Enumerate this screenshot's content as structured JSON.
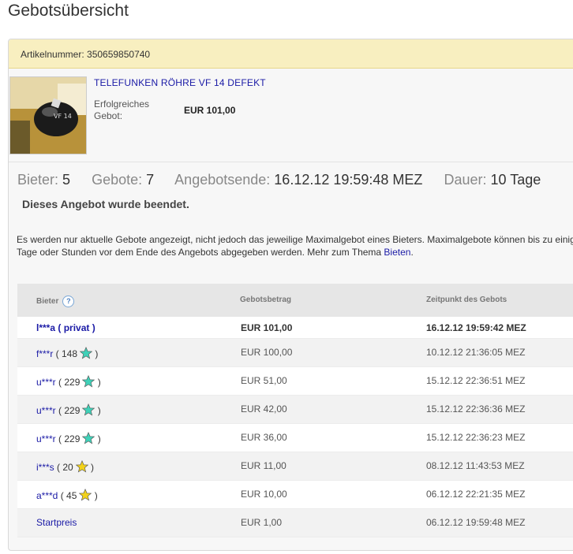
{
  "page": {
    "title": "Gebotsübersicht"
  },
  "item": {
    "number_text": "Artikelnummer: 350659850740",
    "title": "TELEFUNKEN RÖHRE VF 14 DEFEKT",
    "sale_label": "Erfolgreiches Gebot:",
    "sale_price": "EUR 101,00"
  },
  "stats": {
    "bidders_label": "Bieter:",
    "bidders_value": "5",
    "bids_label": "Gebote:",
    "bids_value": "7",
    "end_label": "Angebotsende:",
    "end_value": "16.12.12 19:59:48 MEZ",
    "duration_label": "Dauer:",
    "duration_value": "10 Tage"
  },
  "status": {
    "ended": "Dieses Angebot wurde beendet."
  },
  "info": {
    "line1": "Es werden nur aktuelle Gebote angezeigt, nicht jedoch das jeweilige Maximalgebot eines Bieters. Maximalgebote können bis zu einige",
    "line2": "Tage oder Stunden vor dem Ende des Angebots abgegeben werden. Mehr zum Thema ",
    "link": "Bieten",
    "end": "."
  },
  "table": {
    "headers": {
      "bidder": "Bieter",
      "help": "?",
      "amount": "Gebotsbetrag",
      "time": "Zeitpunkt des Gebots"
    },
    "rows": [
      {
        "name": "l***a",
        "feedback": "( privat )",
        "star": "",
        "close": "",
        "amount": "EUR 101,00",
        "time": "16.12.12 19:59:42 MEZ"
      },
      {
        "name": "f***r",
        "feedback": "( 148",
        "star": "turquoise",
        "close": ")",
        "amount": "EUR 100,00",
        "time": "10.12.12 21:36:05 MEZ"
      },
      {
        "name": "u***r",
        "feedback": "( 229",
        "star": "turquoise",
        "close": ")",
        "amount": "EUR 51,00",
        "time": "15.12.12 22:36:51 MEZ"
      },
      {
        "name": "u***r",
        "feedback": "( 229",
        "star": "turquoise",
        "close": ")",
        "amount": "EUR 42,00",
        "time": "15.12.12 22:36:36 MEZ"
      },
      {
        "name": "u***r",
        "feedback": "( 229",
        "star": "turquoise",
        "close": ")",
        "amount": "EUR 36,00",
        "time": "15.12.12 22:36:23 MEZ"
      },
      {
        "name": "i***s",
        "feedback": "( 20",
        "star": "yellow",
        "close": ")",
        "amount": "EUR 11,00",
        "time": "08.12.12 11:43:53 MEZ"
      },
      {
        "name": "a***d",
        "feedback": "( 45",
        "star": "yellow",
        "close": ")",
        "amount": "EUR 10,00",
        "time": "06.12.12 22:21:35 MEZ"
      },
      {
        "name": "Startpreis",
        "feedback": "",
        "star": "",
        "close": "",
        "amount": "EUR 1,00",
        "time": "06.12.12 19:59:48 MEZ"
      }
    ]
  },
  "colors": {
    "turquoise_star": "#3fd1b8",
    "yellow_star": "#f2d21a",
    "link": "#1a1aa6",
    "banner": "#f8efc0"
  }
}
